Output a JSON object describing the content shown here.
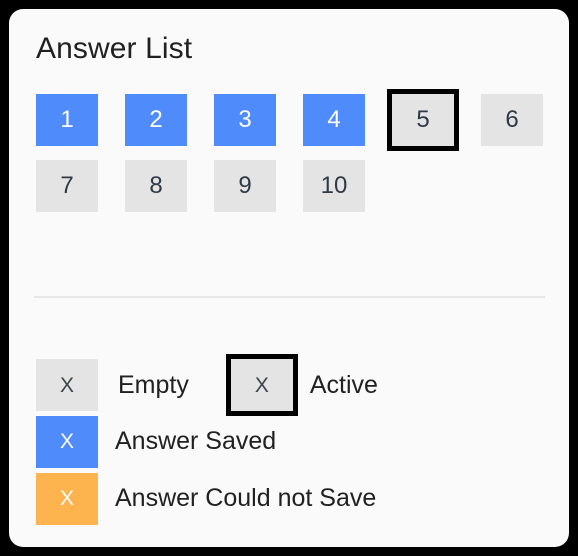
{
  "card": {
    "title": "Answer List"
  },
  "answers": {
    "items": [
      {
        "number": "1",
        "state": "saved",
        "active": false
      },
      {
        "number": "2",
        "state": "saved",
        "active": false
      },
      {
        "number": "3",
        "state": "saved",
        "active": false
      },
      {
        "number": "4",
        "state": "saved",
        "active": false
      },
      {
        "number": "5",
        "state": "empty",
        "active": true
      },
      {
        "number": "6",
        "state": "empty",
        "active": false
      },
      {
        "number": "7",
        "state": "empty",
        "active": false
      },
      {
        "number": "8",
        "state": "empty",
        "active": false
      },
      {
        "number": "9",
        "state": "empty",
        "active": false
      },
      {
        "number": "10",
        "state": "empty",
        "active": false
      }
    ]
  },
  "legend": {
    "sample_glyph": "X",
    "entries": [
      {
        "label": "Empty",
        "state": "empty",
        "active": false
      },
      {
        "label": "Active",
        "state": "empty",
        "active": true
      },
      {
        "label": "Answer Saved",
        "state": "saved",
        "active": false
      },
      {
        "label": "Answer Could not Save",
        "state": "unsaved",
        "active": false
      }
    ]
  },
  "colors": {
    "page_background": "#000000",
    "card_background": "#fafafa",
    "empty": "#e4e4e4",
    "saved": "#4f8bfa",
    "unsaved": "#fdb44e",
    "active_border": "#000000",
    "text": "#212121",
    "divider": "#e7e7e7"
  }
}
